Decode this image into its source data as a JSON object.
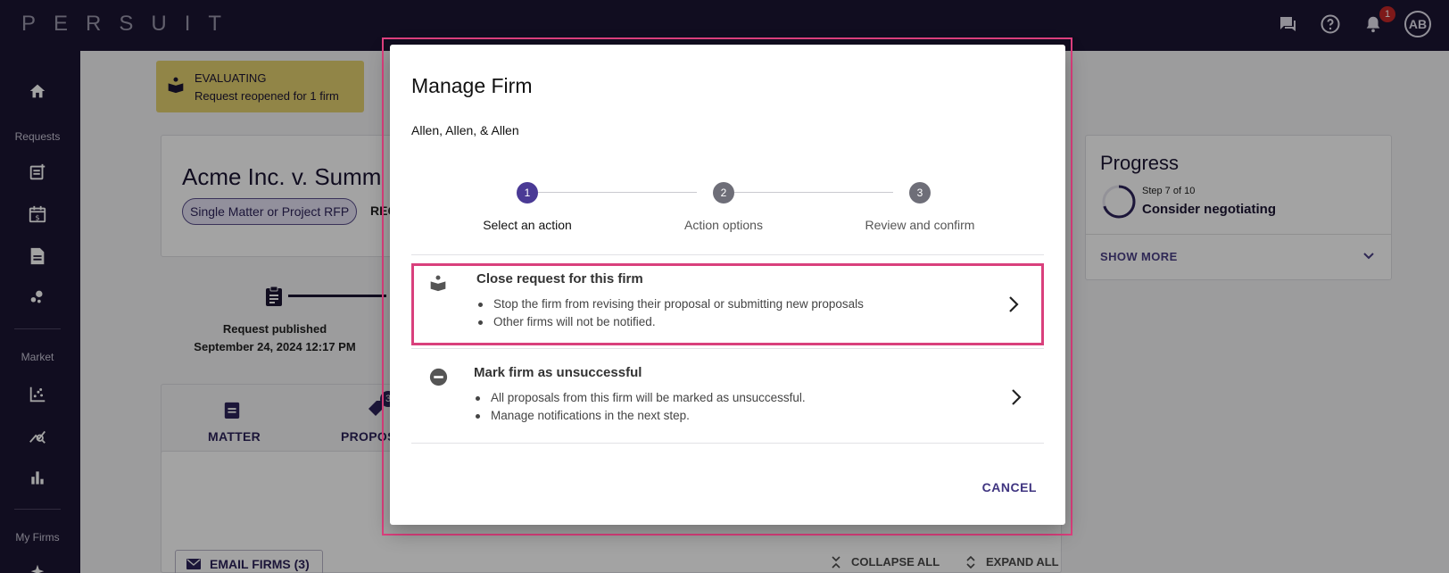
{
  "topbar": {
    "logo": "PERSUIT",
    "notification_count": "1",
    "avatar_initials": "AB"
  },
  "sidebar": {
    "sections": {
      "requests": "Requests",
      "market": "Market",
      "my_firms": "My Firms"
    }
  },
  "status": {
    "title": "EVALUATING",
    "subtitle": "Request reopened for 1 firm"
  },
  "request": {
    "title": "Acme Inc. v. Summ",
    "type_chip": "Single Matter or Project RFP",
    "extra_label": "REC"
  },
  "timeline": {
    "published_label": "Request published",
    "published_date": "September 24, 2024 12:17 PM"
  },
  "tabs": {
    "matter": "MATTER",
    "proposals": "PROPOS",
    "proposals_badge": "3"
  },
  "actions": {
    "email_firms": "EMAIL FIRMS (3)",
    "collapse_all": "COLLAPSE ALL",
    "expand_all": "EXPAND ALL"
  },
  "progress": {
    "title": "Progress",
    "step": "Step 7 of 10",
    "step_name": "Consider negotiating",
    "show_more": "SHOW MORE",
    "fraction": 0.7
  },
  "modal": {
    "title": "Manage Firm",
    "firm_name": "Allen, Allen, & Allen",
    "steps": [
      {
        "number": "1",
        "label": "Select an action"
      },
      {
        "number": "2",
        "label": "Action options"
      },
      {
        "number": "3",
        "label": "Review and confirm"
      }
    ],
    "options": [
      {
        "title": "Close request for this firm",
        "bullets": [
          "Stop the firm from revising their proposal or submitting new proposals",
          "Other firms will not be notified."
        ]
      },
      {
        "title": "Mark firm as unsuccessful",
        "bullets": [
          "All proposals from this firm will be marked as unsuccessful.",
          "Manage notifications in the next step."
        ]
      }
    ],
    "cancel_label": "CANCEL"
  },
  "colors": {
    "nav_bg": "#1c1533",
    "accent": "#4a3f85",
    "active_step": "#4a3a95",
    "inactive_step": "#6e6e78",
    "highlight": "#d9407c",
    "status_bg": "#e3d16f"
  }
}
